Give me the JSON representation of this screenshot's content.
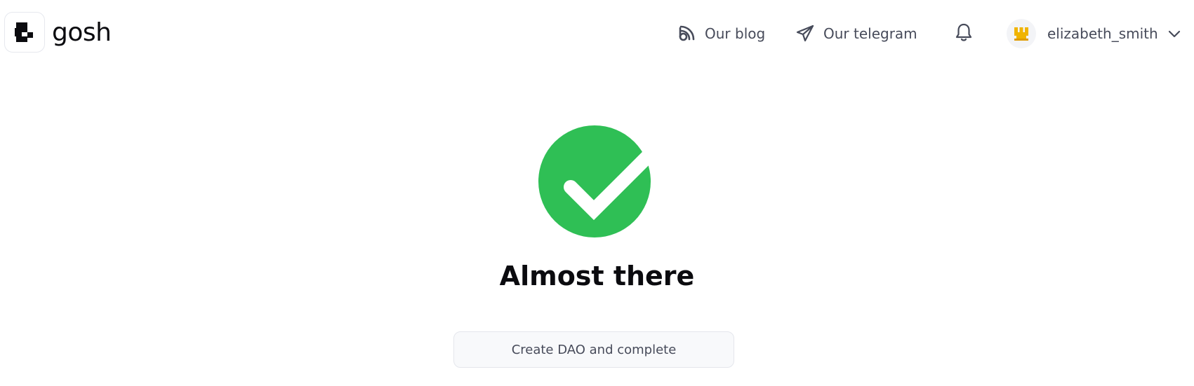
{
  "header": {
    "logo_text": "gosh",
    "nav": {
      "blog_label": "Our blog",
      "telegram_label": "Our telegram"
    },
    "user": {
      "username": "elizabeth_smith"
    }
  },
  "main": {
    "title": "Almost there",
    "cta_label": "Create DAO and complete"
  },
  "colors": {
    "success": "#2fbf55",
    "text_muted": "#474b5a",
    "avatar_gold": "#f0b400"
  },
  "icons": [
    "logo-icon",
    "blog-icon",
    "telegram-icon",
    "bell-icon",
    "avatar-icon",
    "chevron-down-icon",
    "check-icon"
  ]
}
